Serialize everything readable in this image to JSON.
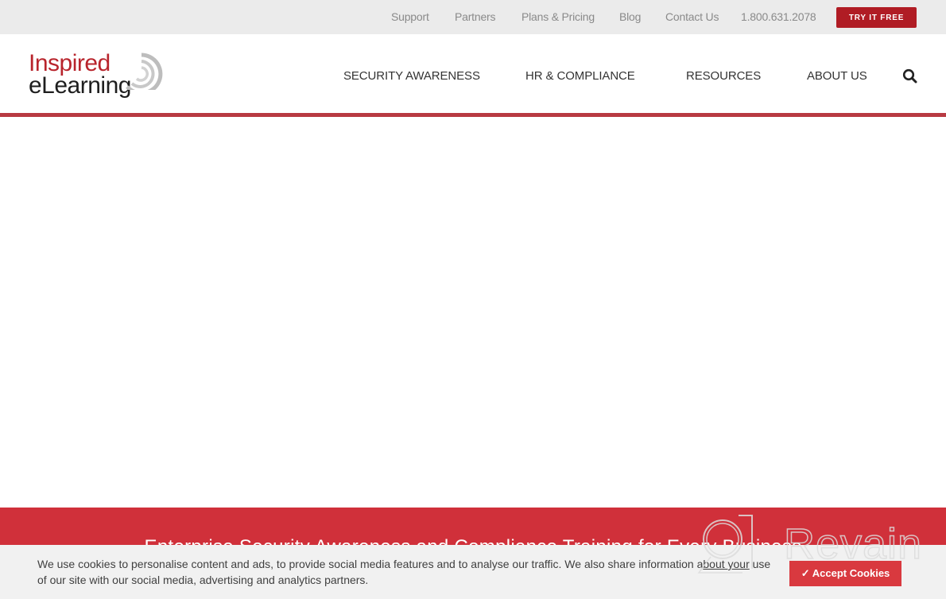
{
  "topbar": {
    "links": [
      {
        "label": "Support"
      },
      {
        "label": "Partners"
      },
      {
        "label": "Plans & Pricing"
      },
      {
        "label": "Blog"
      },
      {
        "label": "Contact Us"
      }
    ],
    "phone": "1.800.631.2078",
    "cta_label": "TRY IT FREE"
  },
  "logo": {
    "line1": "Inspired",
    "line2": "eLearning"
  },
  "nav": {
    "items": [
      {
        "label": "SECURITY AWARENESS"
      },
      {
        "label": "HR & COMPLIANCE"
      },
      {
        "label": "RESOURCES"
      },
      {
        "label": "ABOUT US"
      }
    ],
    "search_icon": "search-icon"
  },
  "band": {
    "headline": "Enterprise Security Awareness and Compliance Training for Every Business"
  },
  "cookie_banner": {
    "text_before": "We use cookies to personalise content and ads, to provide social media features and to analyse our traffic. We also share information a",
    "link_text": "bout your",
    "text_after": " use of our site with our social media, advertising and analytics partners.",
    "accept_label": "✓ Accept Cookies"
  },
  "watermark": {
    "text": "Revain"
  },
  "colors": {
    "brand_red": "#b8242c",
    "cta_red": "#b01c24",
    "band_red": "#d0303a",
    "accept_red": "#d9393f",
    "topbar_bg": "#ebebeb"
  }
}
